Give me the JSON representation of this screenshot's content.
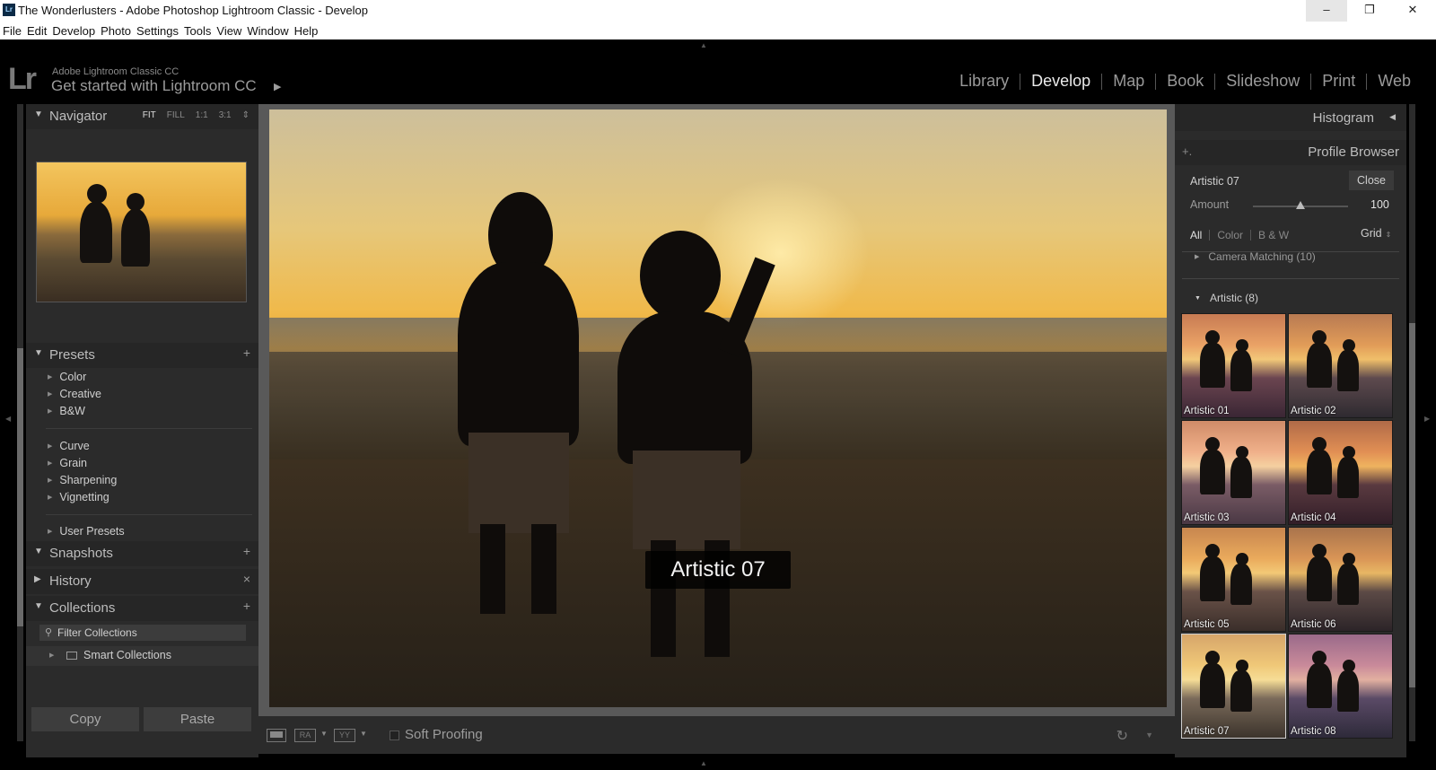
{
  "window": {
    "title": "The Wonderlusters - Adobe Photoshop Lightroom Classic - Develop",
    "app_icon": "Lr",
    "controls": [
      "minimize-icon",
      "maximize-icon",
      "close-icon"
    ]
  },
  "menubar": [
    "File",
    "Edit",
    "Develop",
    "Photo",
    "Settings",
    "Tools",
    "View",
    "Window",
    "Help"
  ],
  "identity": {
    "logo": "Lr",
    "line1": "Adobe Lightroom Classic CC",
    "line2": "Get started with Lightroom CC"
  },
  "modules": [
    {
      "label": "Library",
      "active": false
    },
    {
      "label": "Develop",
      "active": true
    },
    {
      "label": "Map",
      "active": false
    },
    {
      "label": "Book",
      "active": false
    },
    {
      "label": "Slideshow",
      "active": false
    },
    {
      "label": "Print",
      "active": false
    },
    {
      "label": "Web",
      "active": false
    }
  ],
  "left_panel": {
    "navigator": {
      "title": "Navigator",
      "modes": [
        "FIT",
        "FILL",
        "1:1",
        "3:1"
      ],
      "active_mode": "FIT"
    },
    "presets": {
      "title": "Presets",
      "group1": [
        "Color",
        "Creative",
        "B&W"
      ],
      "group2": [
        "Curve",
        "Grain",
        "Sharpening",
        "Vignetting"
      ],
      "group3": [
        "User Presets"
      ]
    },
    "snapshots": {
      "title": "Snapshots"
    },
    "history": {
      "title": "History"
    },
    "collections": {
      "title": "Collections",
      "filter_placeholder": "Filter Collections",
      "smart": "Smart Collections"
    },
    "copy_label": "Copy",
    "paste_label": "Paste"
  },
  "center": {
    "overlay_label": "Artistic 07"
  },
  "toolbar": {
    "view_modes": [
      "loupe",
      "RA",
      "YY"
    ],
    "soft_proofing": "Soft Proofing"
  },
  "right_panel": {
    "histogram": "Histogram",
    "profile_browser": "Profile Browser",
    "current_profile": "Artistic 07",
    "close_label": "Close",
    "amount_label": "Amount",
    "amount_value": "100",
    "amount_fraction": 0.5,
    "filters": [
      "All",
      "Color",
      "B & W"
    ],
    "active_filter": "All",
    "grid_label": "Grid",
    "group_collapsed": "Camera Matching (10)",
    "group_open": "Artistic (8)",
    "profiles": [
      "Artistic 01",
      "Artistic 02",
      "Artistic 03",
      "Artistic 04",
      "Artistic 05",
      "Artistic 06",
      "Artistic 07",
      "Artistic 08"
    ],
    "selected_profile": "Artistic 07"
  }
}
